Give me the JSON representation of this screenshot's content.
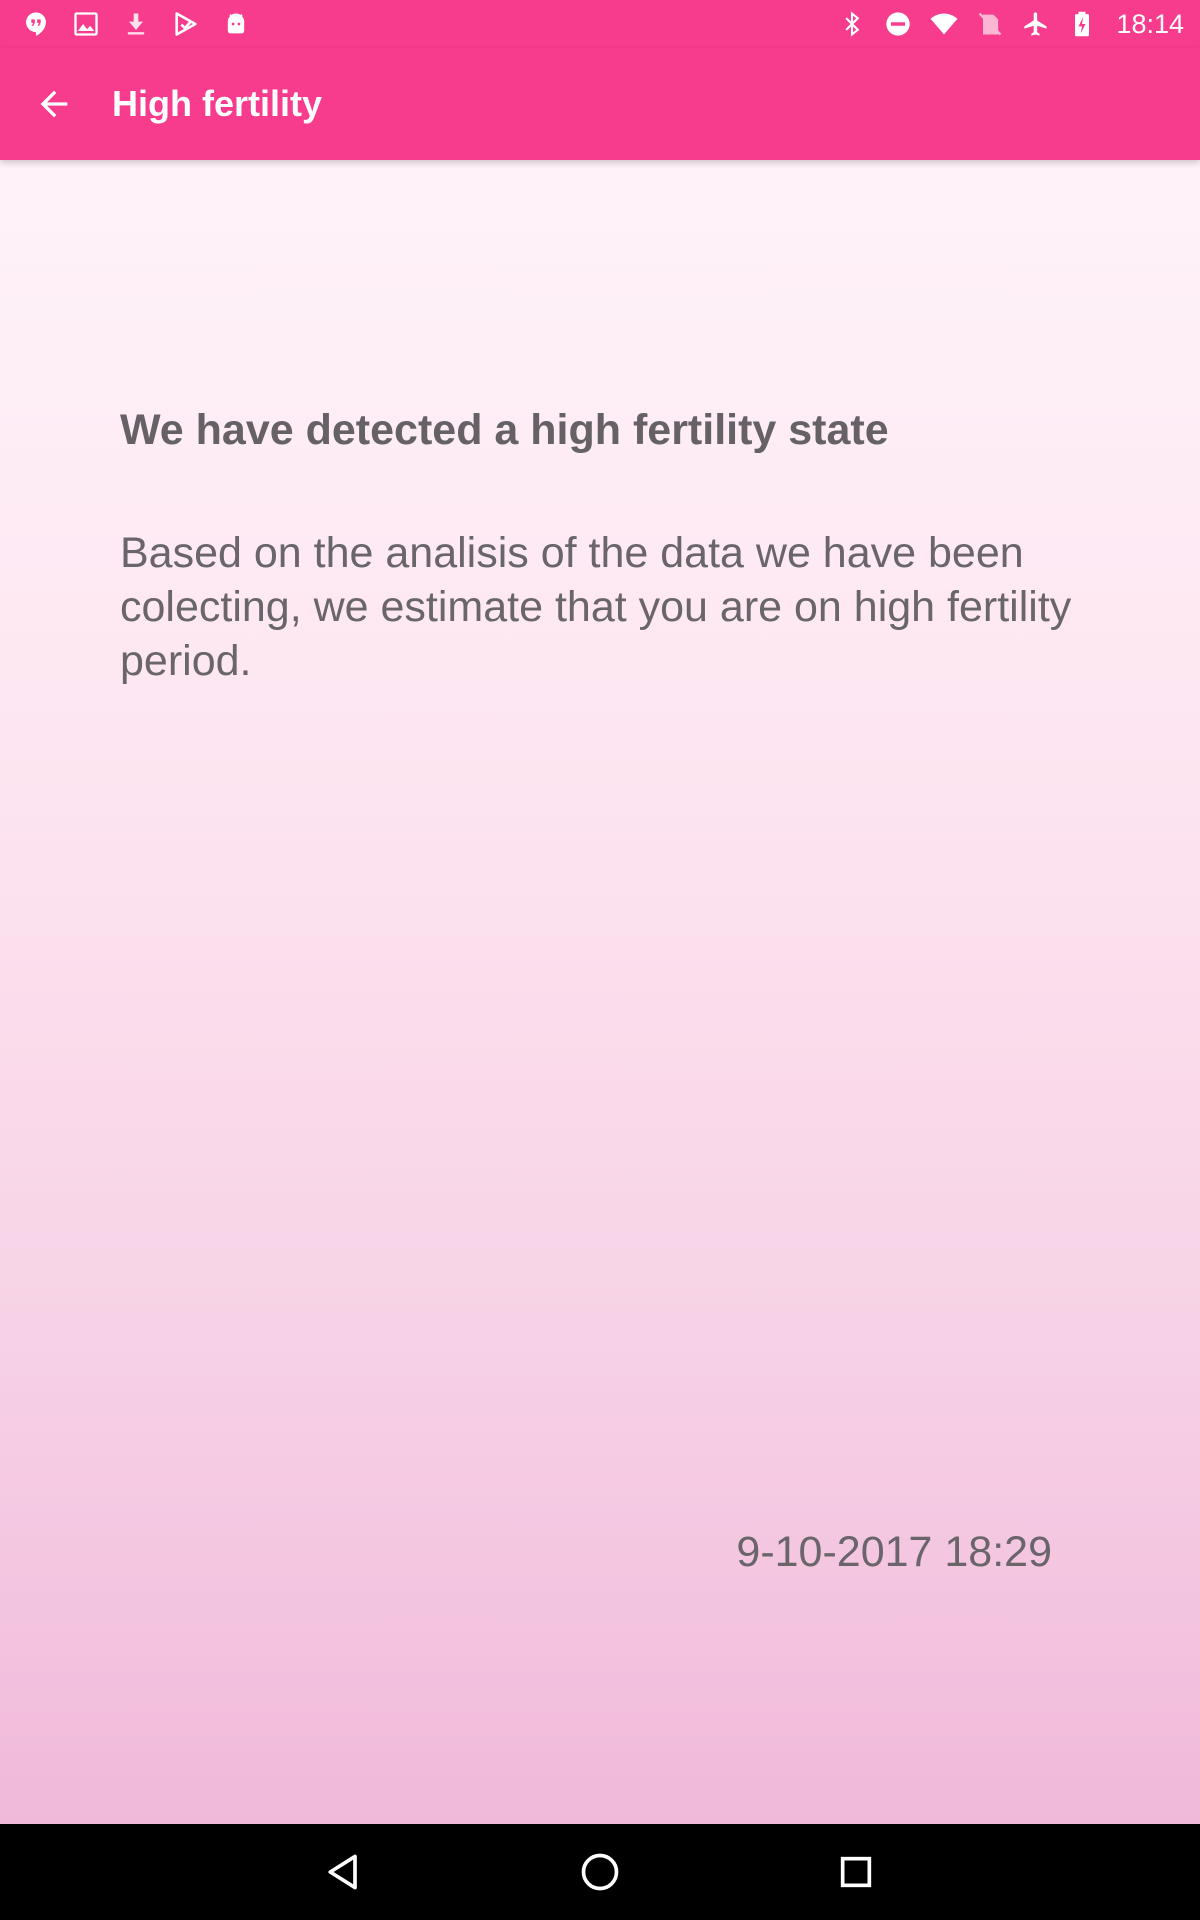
{
  "status_bar": {
    "time": "18:14",
    "left_icons": [
      "hangouts-icon",
      "image-icon",
      "download-icon",
      "play-store-icon",
      "android-icon"
    ],
    "right_icons": [
      "bluetooth-icon",
      "do-not-disturb-icon",
      "wifi-icon",
      "no-sim-icon",
      "airplane-icon",
      "battery-charging-icon"
    ]
  },
  "app_bar": {
    "title": "High fertility",
    "back_icon": "arrow-back-icon",
    "color": "#f73b8d"
  },
  "content": {
    "headline": "We have detected a high fertility state",
    "body": "Based on the analisis of the data we have been colecting, we estimate that you are on high fertility period.",
    "timestamp": "9-10-2017 18:29",
    "text_color": "#666166"
  },
  "nav_bar": {
    "buttons": [
      "back-triangle-icon",
      "home-circle-icon",
      "recents-square-icon"
    ]
  }
}
